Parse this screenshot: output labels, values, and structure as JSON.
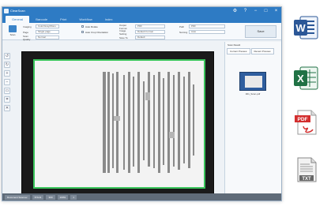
{
  "window": {
    "title": "ClearScan"
  },
  "tabs": [
    {
      "label": "General"
    },
    {
      "label": "Barcode"
    },
    {
      "label": "Print"
    },
    {
      "label": "Workflow"
    },
    {
      "label": "Index"
    }
  ],
  "ribbon": {
    "scan_label": "Scan",
    "imaging_label": "Imaging",
    "imaging_value": "Color/Gray/Mono",
    "page_label": "Page",
    "page_value": "Single page",
    "quality_label": "Scan Quality",
    "quality_value": "Normal",
    "auto_rotate_label": "Auto Rotate",
    "auto_crop_label": "Auto Crop Orientation",
    "output_format_label": "Output Format",
    "output_format_value": "PDF",
    "image_setting_label": "Image Setting",
    "image_setting_value": "Default Format",
    "save_to_label": "Save To",
    "save_to_value": "Default",
    "path_label": "Path",
    "path_value": "PDF",
    "naming_label": "Naming",
    "naming_value": "Auto",
    "save_button": "Save"
  },
  "right_panel": {
    "header": "Scan Result",
    "tab1": "Current Preview",
    "tab2": "Recent Preview",
    "thumb_label": "001_Scan.pdf"
  },
  "status": {
    "device": "Document Scanner",
    "size": "8.5x11",
    "dpi": "300",
    "zoom": "100%",
    "pages": "1"
  },
  "colors": {
    "accent": "#2e7bc4",
    "word": "#2b5797",
    "excel": "#207245",
    "pdf": "#d32f2f"
  },
  "file_icons": [
    {
      "name": "word-icon",
      "letter": "W"
    },
    {
      "name": "excel-icon",
      "letter": "X"
    },
    {
      "name": "pdf-icon",
      "label": "PDF"
    },
    {
      "name": "txt-icon",
      "label": "TXT"
    }
  ]
}
